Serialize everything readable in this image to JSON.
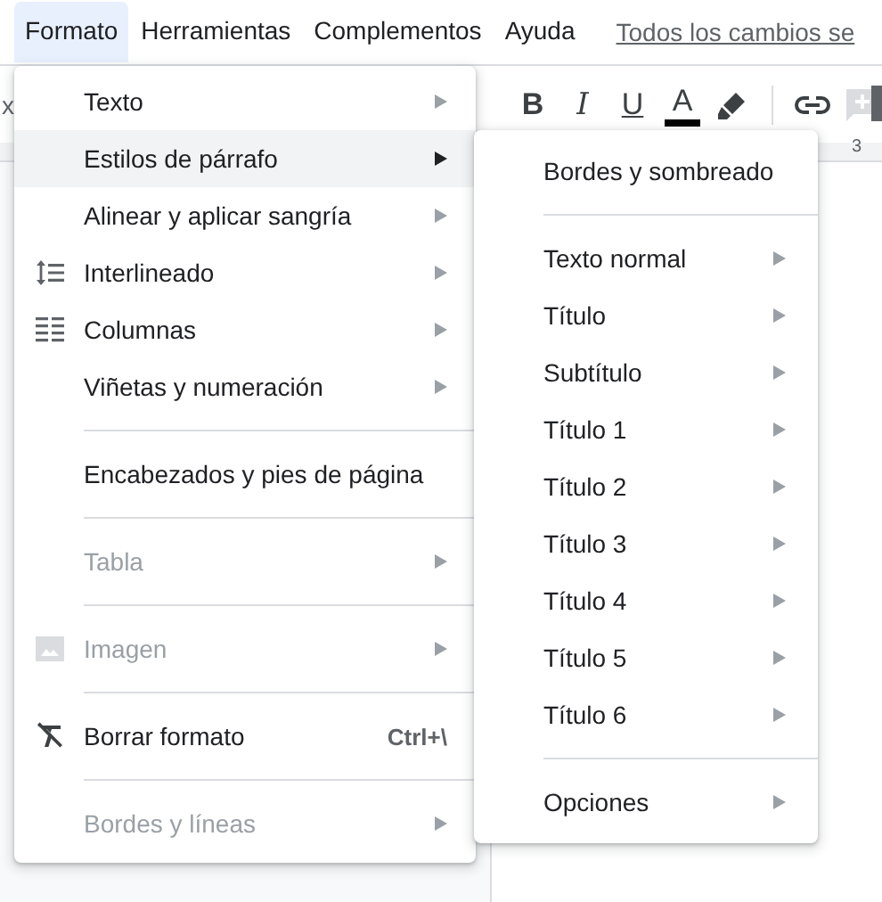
{
  "menubar": [
    {
      "label": "Formato",
      "selected": true
    },
    {
      "label": "Herramientas",
      "selected": false
    },
    {
      "label": "Complementos",
      "selected": false
    },
    {
      "label": "Ayuda",
      "selected": false
    }
  ],
  "save_status": "Todos los cambios se",
  "toolbar": {
    "left_fragment": "x",
    "format_buttons": [
      "B",
      "I",
      "U",
      "A"
    ]
  },
  "ruler": {
    "mark": "3"
  },
  "format_menu": [
    {
      "kind": "item",
      "label": "Texto",
      "submenu": true,
      "disabled": false,
      "selected": false
    },
    {
      "kind": "item",
      "label": "Estilos de párrafo",
      "submenu": true,
      "disabled": false,
      "selected": true
    },
    {
      "kind": "item",
      "label": "Alinear y aplicar sangría",
      "submenu": true,
      "disabled": false,
      "selected": false
    },
    {
      "kind": "item",
      "label": "Interlineado",
      "submenu": true,
      "disabled": false,
      "selected": false
    },
    {
      "kind": "item",
      "label": "Columnas",
      "submenu": true,
      "disabled": false,
      "selected": false
    },
    {
      "kind": "item",
      "label": "Viñetas y numeración",
      "submenu": true,
      "disabled": false,
      "selected": false
    },
    {
      "kind": "separator"
    },
    {
      "kind": "item",
      "label": "Encabezados y pies de página",
      "submenu": false,
      "disabled": false,
      "selected": false
    },
    {
      "kind": "separator"
    },
    {
      "kind": "item",
      "label": "Tabla",
      "submenu": true,
      "disabled": true,
      "selected": false
    },
    {
      "kind": "separator"
    },
    {
      "kind": "item",
      "label": "Imagen",
      "submenu": true,
      "disabled": true,
      "selected": false
    },
    {
      "kind": "separator"
    },
    {
      "kind": "item",
      "label": "Borrar formato",
      "submenu": false,
      "shortcut": "Ctrl+\\",
      "disabled": false,
      "selected": false
    },
    {
      "kind": "separator"
    },
    {
      "kind": "item",
      "label": "Bordes y líneas",
      "submenu": true,
      "disabled": true,
      "selected": false
    }
  ],
  "paragraph_styles_menu": [
    {
      "kind": "item",
      "label": "Bordes y sombreado",
      "submenu": false,
      "selected": false
    },
    {
      "kind": "separator"
    },
    {
      "kind": "item",
      "label": "Texto normal",
      "submenu": true,
      "selected": false
    },
    {
      "kind": "item",
      "label": "Título",
      "submenu": true,
      "selected": false
    },
    {
      "kind": "item",
      "label": "Subtítulo",
      "submenu": true,
      "selected": false
    },
    {
      "kind": "item",
      "label": "Título 1",
      "submenu": true,
      "selected": false
    },
    {
      "kind": "item",
      "label": "Título 2",
      "submenu": true,
      "selected": false
    },
    {
      "kind": "item",
      "label": "Título 3",
      "submenu": true,
      "selected": false
    },
    {
      "kind": "item",
      "label": "Título 4",
      "submenu": true,
      "selected": false
    },
    {
      "kind": "item",
      "label": "Título 5",
      "submenu": true,
      "selected": false
    },
    {
      "kind": "item",
      "label": "Título 6",
      "submenu": true,
      "selected": false
    },
    {
      "kind": "separator"
    },
    {
      "kind": "item",
      "label": "Opciones",
      "submenu": true,
      "selected": false
    }
  ]
}
